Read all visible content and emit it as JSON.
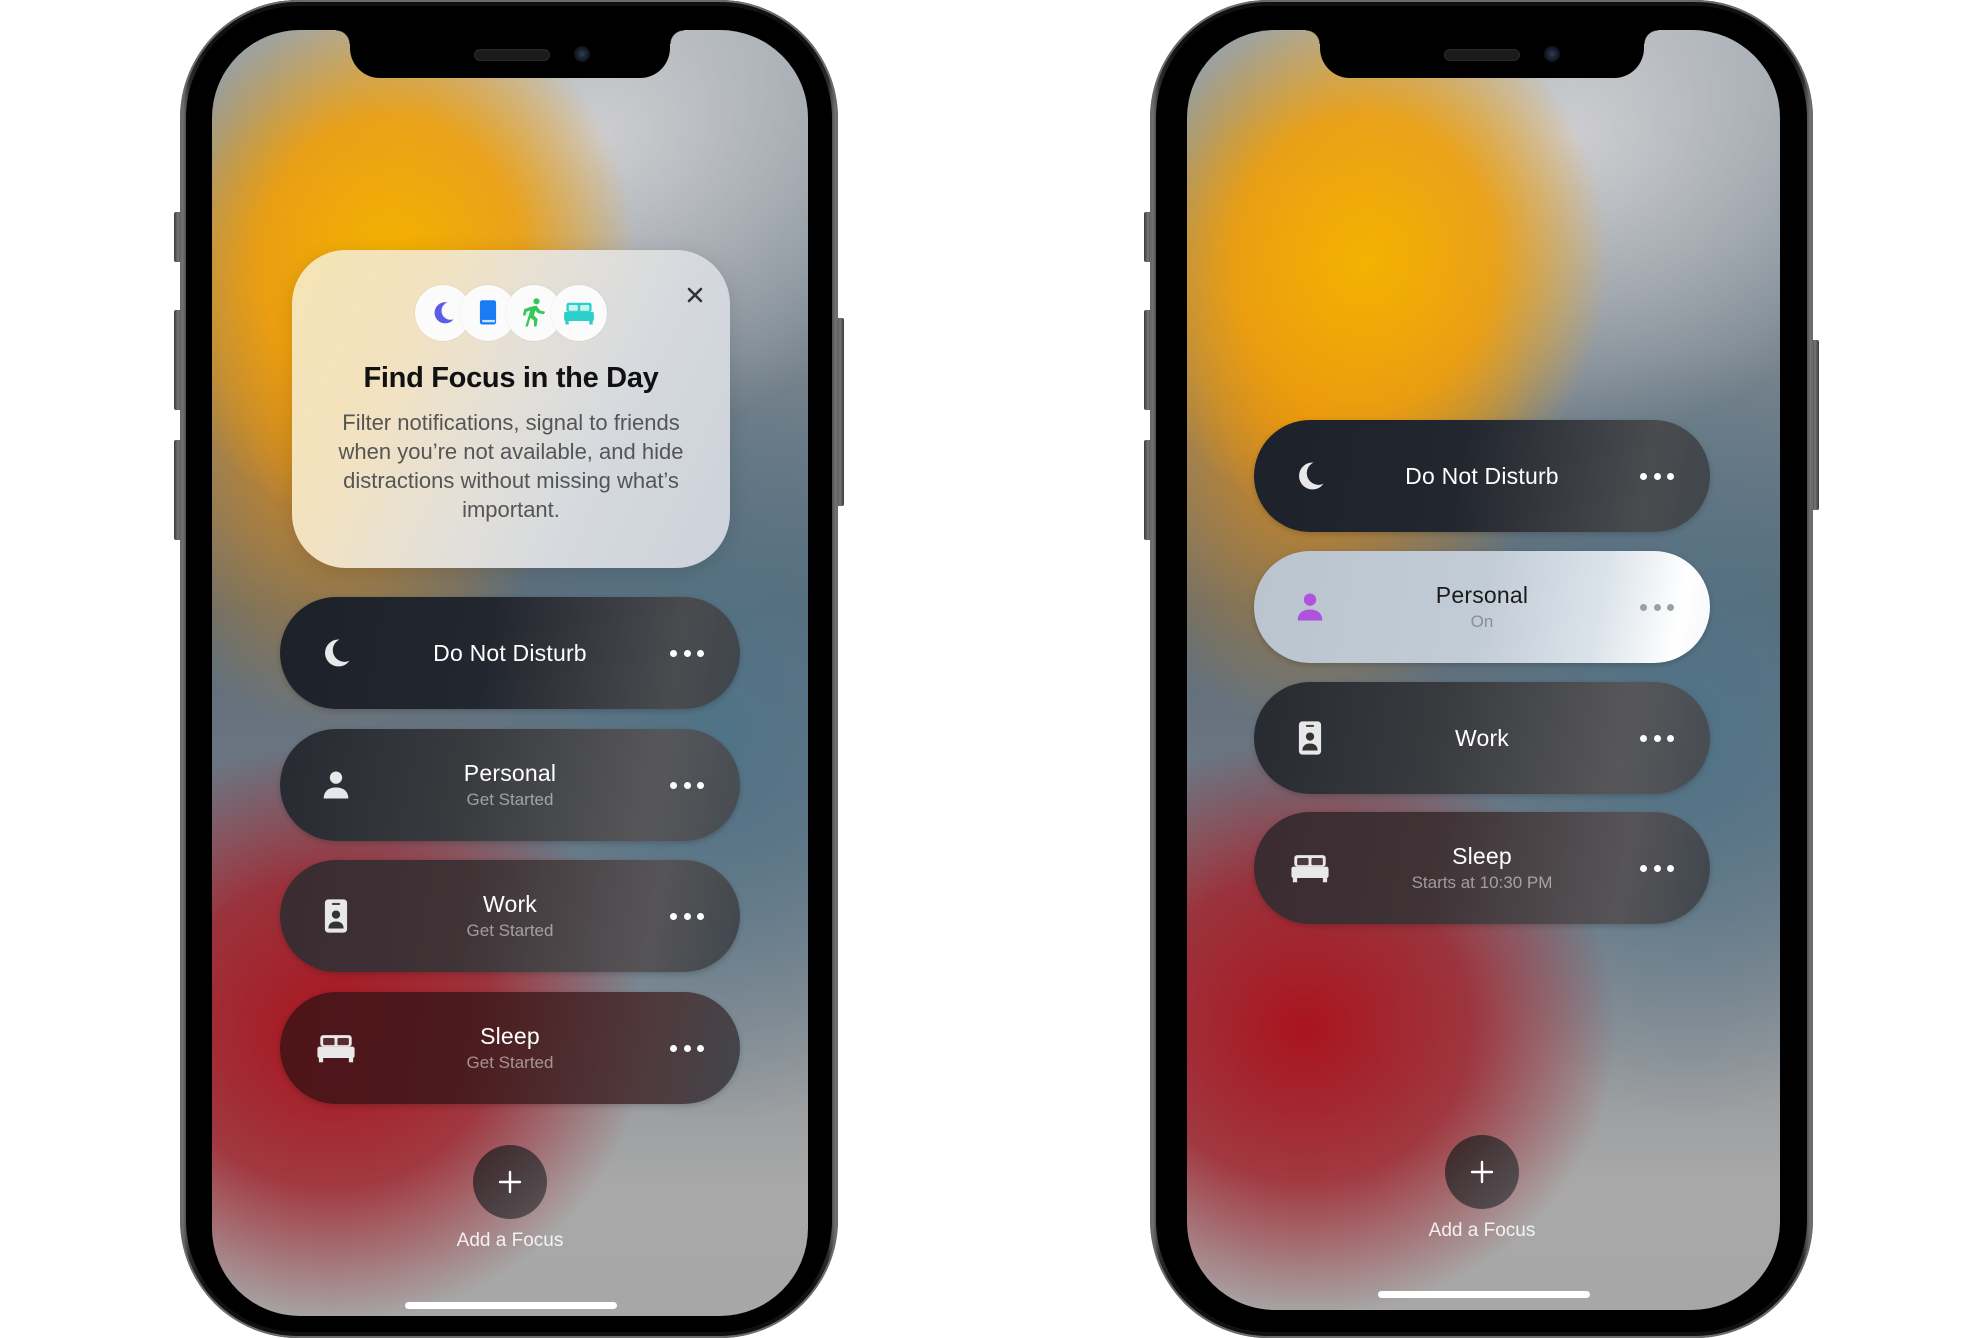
{
  "colors": {
    "moon": "#5e5ce6",
    "book": "#1a7cf5",
    "fitness": "#34c759",
    "bed": "#2ccfc9",
    "personal_active": "#af52de"
  },
  "left_phone": {
    "intro_card": {
      "icons": [
        "moon-icon",
        "book-icon",
        "running-figure-icon",
        "bed-icon"
      ],
      "close_icon": "close-icon",
      "title": "Find Focus in the Day",
      "body": "Filter notifications, signal to friends when you’re not available, and hide distractions without missing what’s important."
    },
    "focus_modes": [
      {
        "name": "Do Not Disturb",
        "status": "",
        "icon": "moon-icon",
        "more_icon": "ellipsis-icon"
      },
      {
        "name": "Personal",
        "status": "Get Started",
        "icon": "person-icon",
        "more_icon": "ellipsis-icon"
      },
      {
        "name": "Work",
        "status": "Get Started",
        "icon": "id-badge-icon",
        "more_icon": "ellipsis-icon"
      },
      {
        "name": "Sleep",
        "status": "Get Started",
        "icon": "bed-icon",
        "more_icon": "ellipsis-icon"
      }
    ],
    "add_focus": {
      "icon": "plus-icon",
      "label": "Add a Focus"
    }
  },
  "right_phone": {
    "focus_modes": [
      {
        "name": "Do Not Disturb",
        "status": "",
        "icon": "moon-icon",
        "active": false,
        "more_icon": "ellipsis-icon"
      },
      {
        "name": "Personal",
        "status": "On",
        "icon": "person-icon",
        "active": true,
        "more_icon": "ellipsis-icon"
      },
      {
        "name": "Work",
        "status": "",
        "icon": "id-badge-icon",
        "active": false,
        "more_icon": "ellipsis-icon"
      },
      {
        "name": "Sleep",
        "status": "Starts at 10:30 PM",
        "icon": "bed-icon",
        "active": false,
        "more_icon": "ellipsis-icon"
      }
    ],
    "add_focus": {
      "icon": "plus-icon",
      "label": "Add a Focus"
    }
  }
}
